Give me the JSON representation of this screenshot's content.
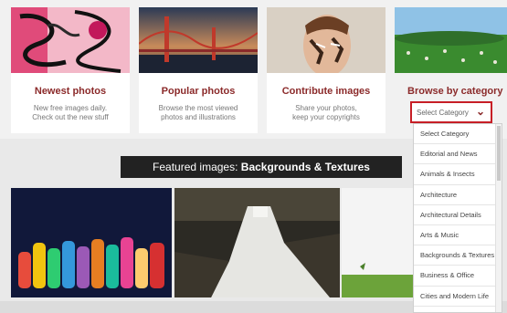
{
  "cards": [
    {
      "title": "Newest photos",
      "desc": [
        "New free images daily.",
        "Check out the new stuff"
      ]
    },
    {
      "title": "Popular photos",
      "desc": [
        "Browse the most viewed",
        "photos and illustrations"
      ]
    },
    {
      "title": "Contribute images",
      "desc": [
        "Share your photos,",
        "keep your copyrights"
      ]
    }
  ],
  "browse": {
    "title": "Browse by category",
    "selected": "Select Category"
  },
  "featured": {
    "prefix": "Featured images:",
    "bold": "Backgrounds & Textures"
  },
  "dropdown": {
    "options": [
      "Select Category",
      "Editorial and News",
      "Animals & Insects",
      "Architecture",
      "Architectural Details",
      "Arts & Music",
      "Backgrounds & Textures",
      "Business & Office",
      "Cities and Modern Life"
    ]
  }
}
